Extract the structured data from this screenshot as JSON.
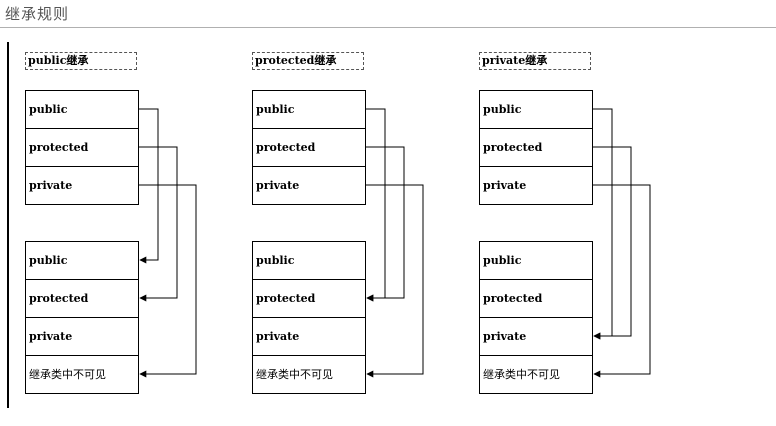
{
  "page_title": "继承规则",
  "panels": [
    {
      "title": "public继承",
      "base_members": [
        "public",
        "protected",
        "private"
      ],
      "derived_members": [
        "public",
        "protected",
        "private",
        "继承类中不可见"
      ],
      "mapping": {
        "public": "public",
        "protected": "protected",
        "private": "继承类中不可见"
      }
    },
    {
      "title": "protected继承",
      "base_members": [
        "public",
        "protected",
        "private"
      ],
      "derived_members": [
        "public",
        "protected",
        "private",
        "继承类中不可见"
      ],
      "mapping": {
        "public": "protected",
        "protected": "protected",
        "private": "继承类中不可见"
      }
    },
    {
      "title": "private继承",
      "base_members": [
        "public",
        "protected",
        "private"
      ],
      "derived_members": [
        "public",
        "protected",
        "private",
        "继承类中不可见"
      ],
      "mapping": {
        "public": "private",
        "protected": "private",
        "private": "继承类中不可见"
      }
    }
  ]
}
